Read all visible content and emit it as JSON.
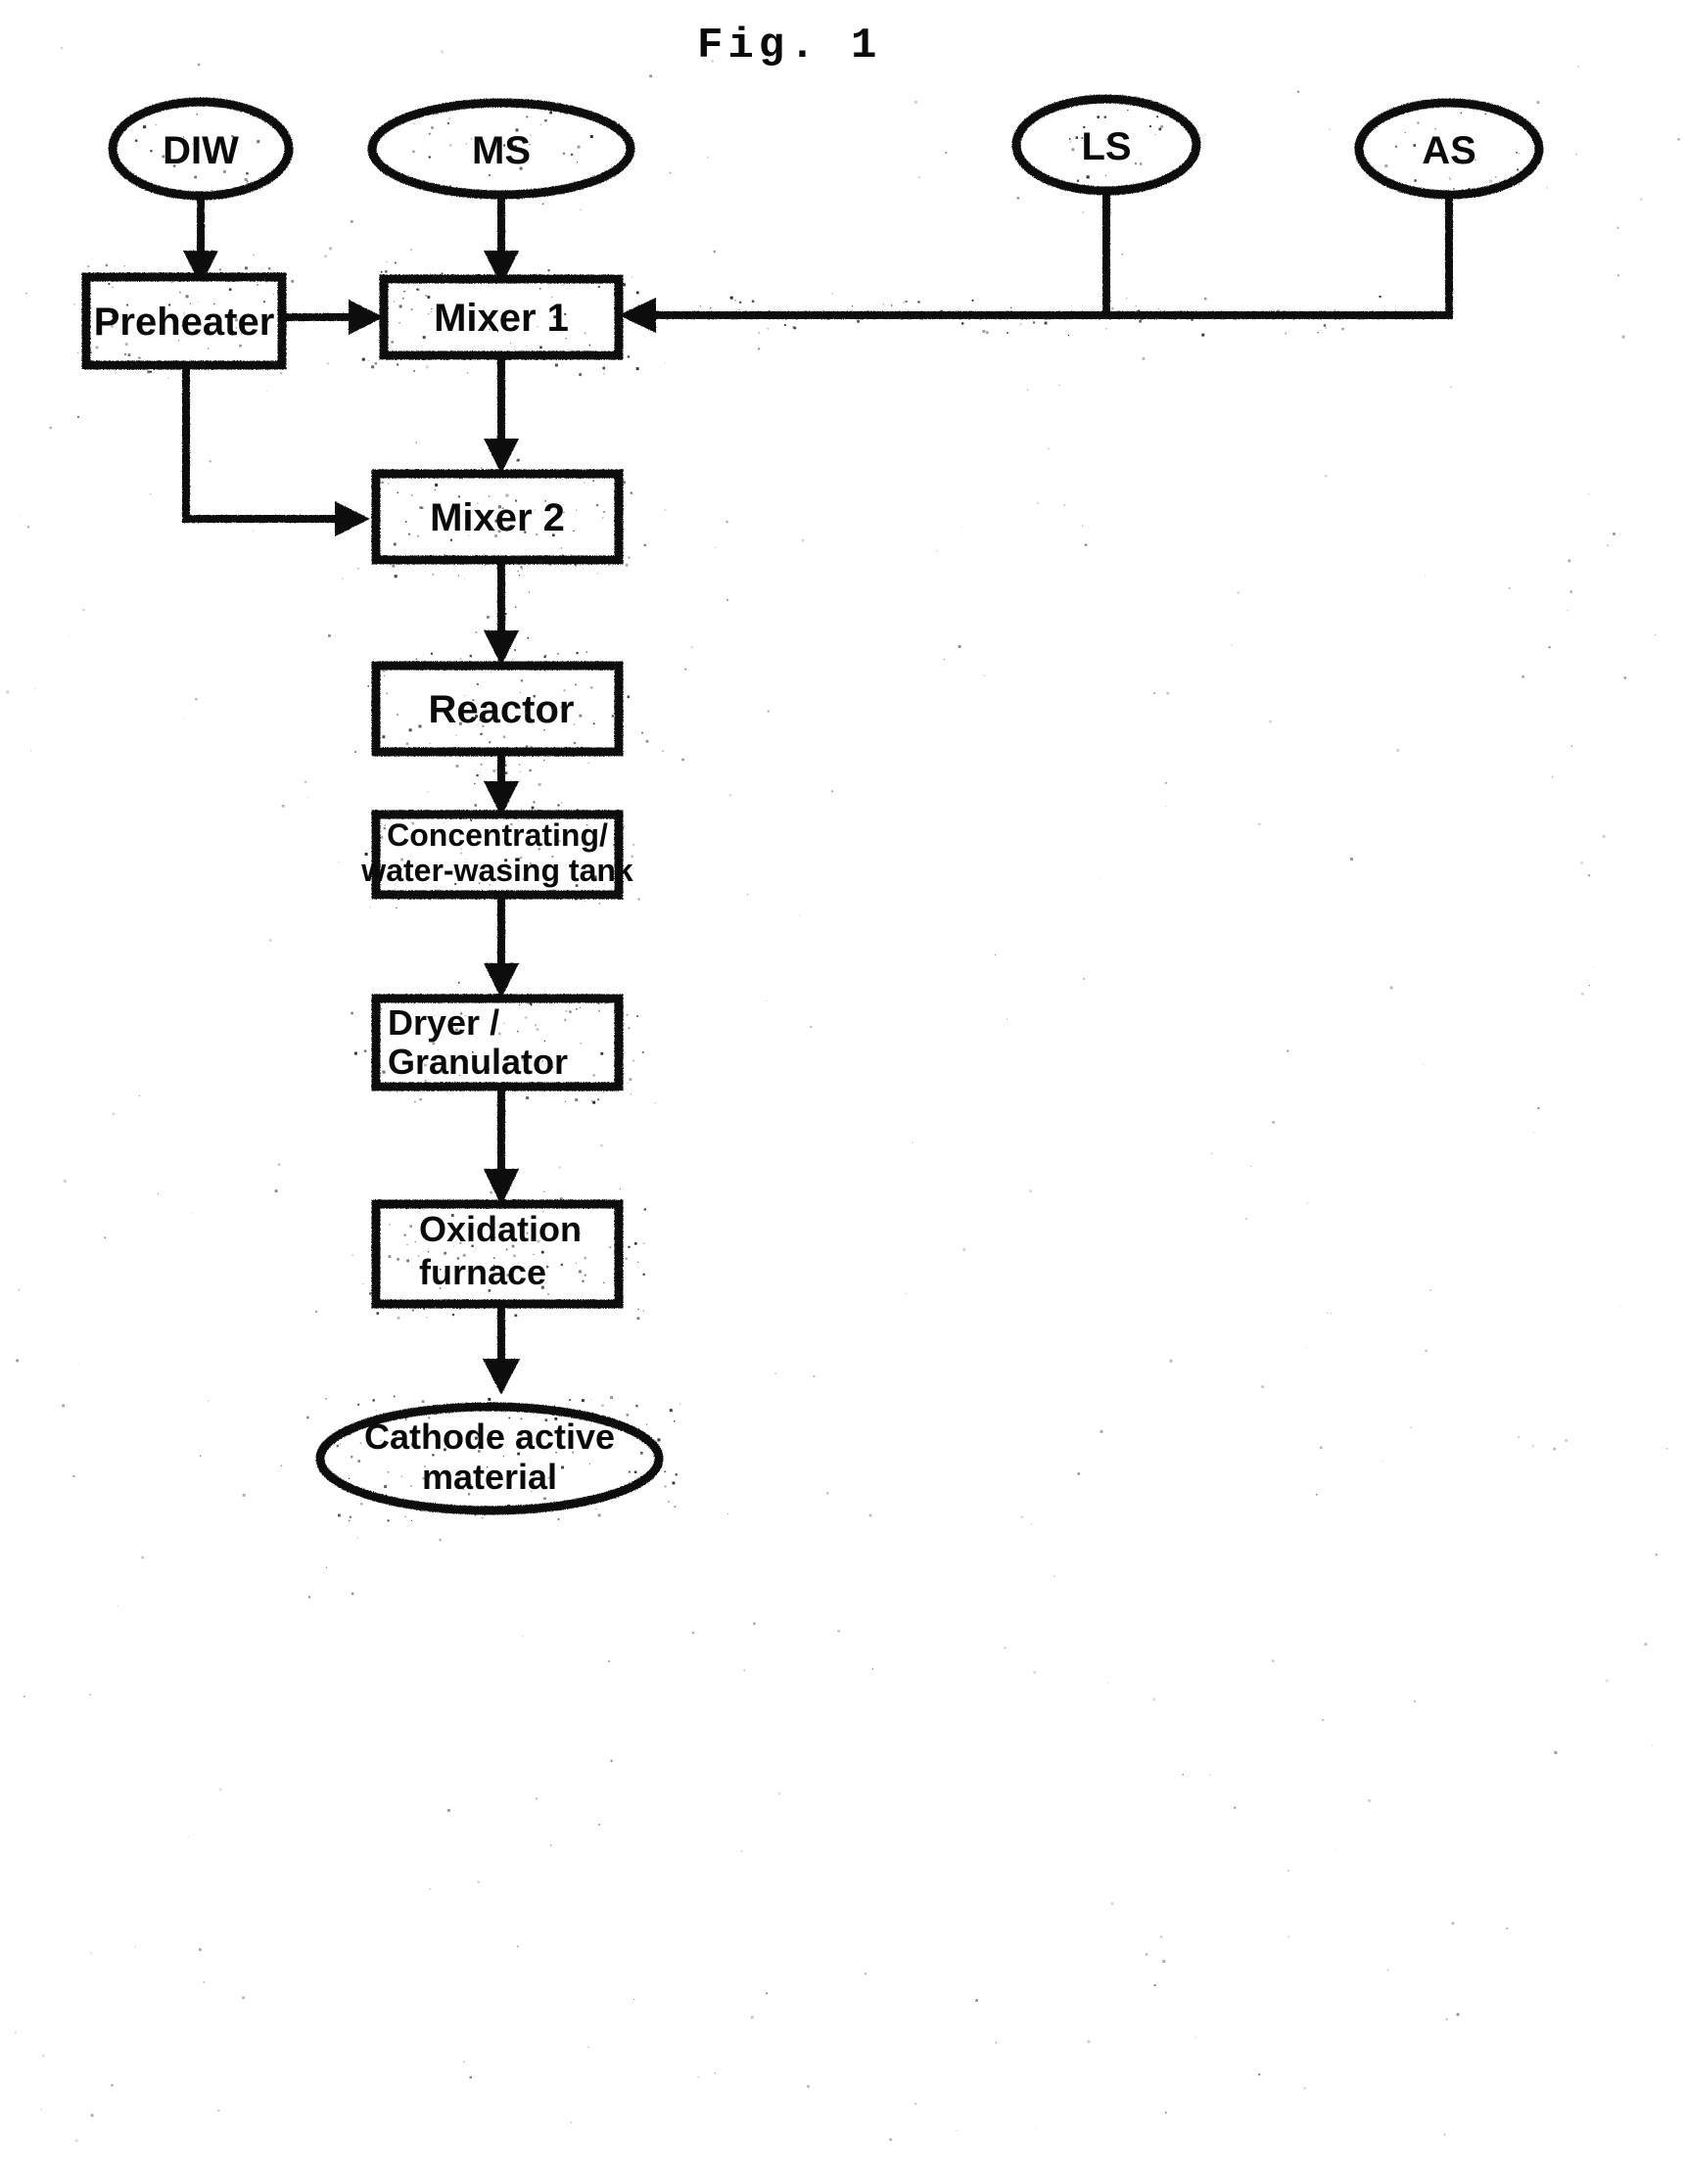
{
  "figure": {
    "title": "Fig. 1",
    "ink_color": "#0a0a0a",
    "background_color": "#ffffff"
  },
  "inputs": [
    {
      "id": "diw",
      "label": "DIW",
      "shape": "ellipse"
    },
    {
      "id": "ms",
      "label": "MS",
      "shape": "ellipse"
    },
    {
      "id": "ls",
      "label": "LS",
      "shape": "ellipse"
    },
    {
      "id": "as",
      "label": "AS",
      "shape": "ellipse"
    }
  ],
  "process_steps": [
    {
      "id": "preheater",
      "label": "Preheater",
      "shape": "box"
    },
    {
      "id": "mixer1",
      "label": "Mixer 1",
      "shape": "box"
    },
    {
      "id": "mixer2",
      "label": "Mixer 2",
      "shape": "box"
    },
    {
      "id": "reactor",
      "label": "Reactor",
      "shape": "box"
    },
    {
      "id": "conc_tank",
      "label_line1": "Concentrating/",
      "label_line2": "water-wasing tank",
      "shape": "box"
    },
    {
      "id": "dryer",
      "label_line1": "Dryer /",
      "label_line2": "Granulator",
      "shape": "box"
    },
    {
      "id": "oxidation",
      "label_line1": "Oxidation",
      "label_line2": "furnace",
      "shape": "box"
    }
  ],
  "output": {
    "id": "cathode",
    "label_line1": "Cathode active",
    "label_line2": "material",
    "shape": "ellipse"
  },
  "connections": [
    {
      "from": "diw",
      "to": "preheater",
      "kind": "arrow-down"
    },
    {
      "from": "ms",
      "to": "mixer1",
      "kind": "arrow-down"
    },
    {
      "from": "ls",
      "to": "mixer1",
      "kind": "elbow-left-arrow"
    },
    {
      "from": "as",
      "to": "mixer1",
      "kind": "elbow-left-arrow"
    },
    {
      "from": "preheater",
      "to": "mixer1",
      "kind": "arrow-right"
    },
    {
      "from": "preheater",
      "to": "mixer2",
      "kind": "elbow-down-right-arrow"
    },
    {
      "from": "mixer1",
      "to": "mixer2",
      "kind": "arrow-down"
    },
    {
      "from": "mixer2",
      "to": "reactor",
      "kind": "arrow-down"
    },
    {
      "from": "reactor",
      "to": "conc_tank",
      "kind": "arrow-down"
    },
    {
      "from": "conc_tank",
      "to": "dryer",
      "kind": "arrow-down"
    },
    {
      "from": "dryer",
      "to": "oxidation",
      "kind": "arrow-down"
    },
    {
      "from": "oxidation",
      "to": "cathode",
      "kind": "arrow-down"
    }
  ]
}
